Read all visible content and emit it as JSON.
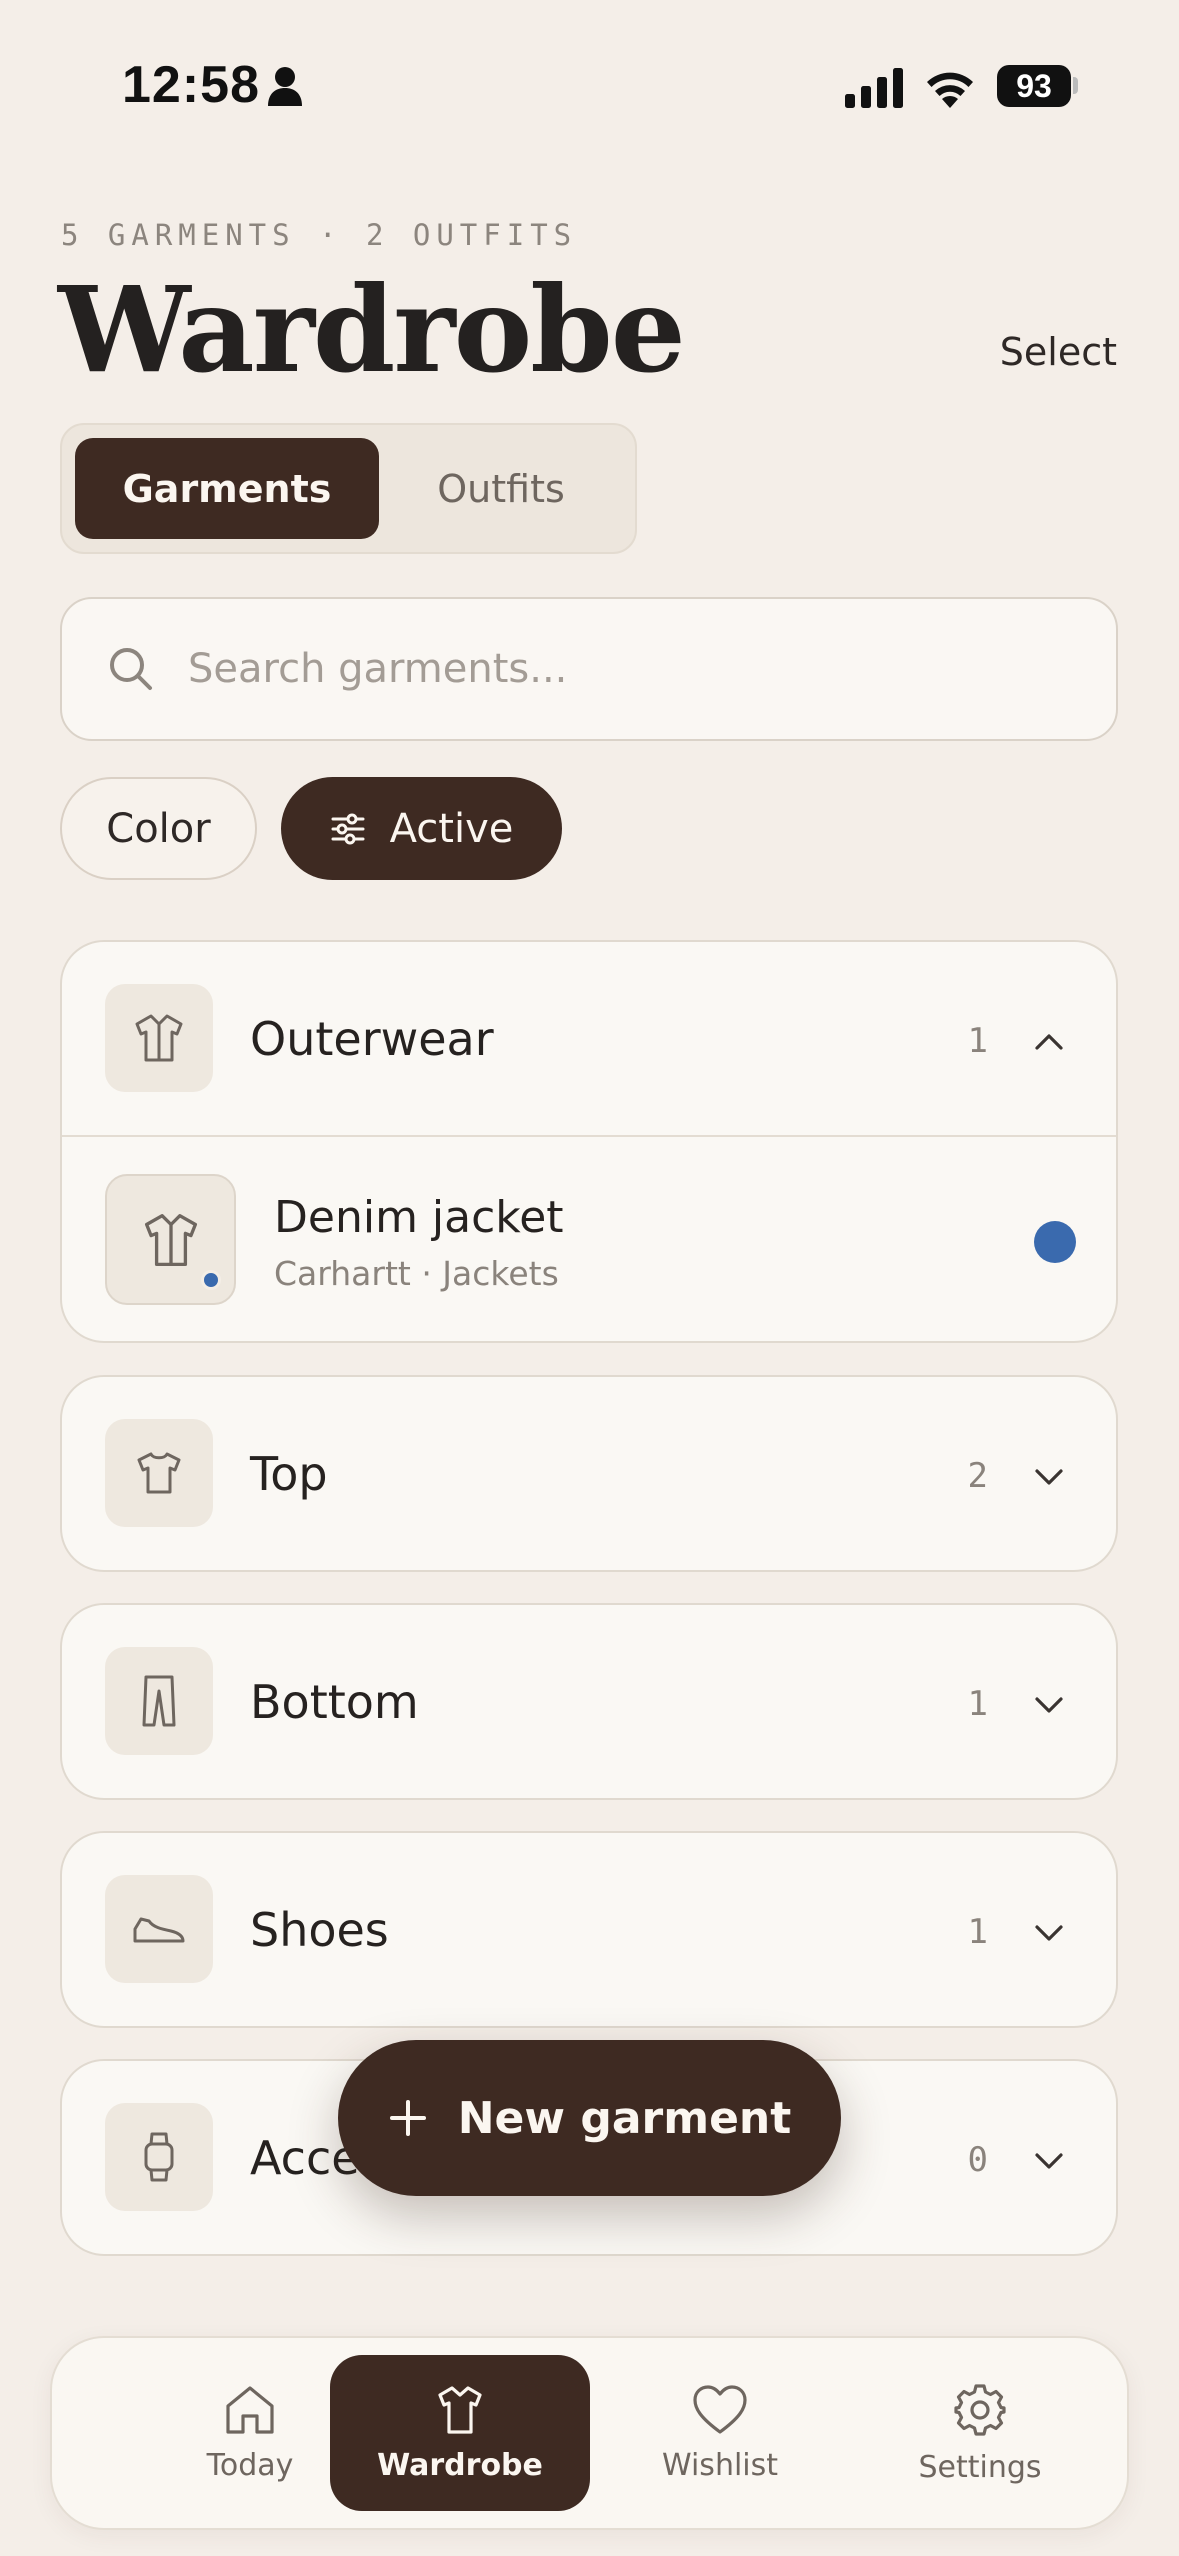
{
  "status_bar": {
    "time": "12:58",
    "battery": "93",
    "icons": [
      "person-icon",
      "signal-icon",
      "wifi-icon",
      "battery-icon"
    ]
  },
  "header": {
    "subtitle": "5 GARMENTS · 2 OUTFITS",
    "title": "Wardrobe",
    "select_label": "Select"
  },
  "segments": {
    "garments": "Garments",
    "outfits": "Outfits",
    "selected": "Garments"
  },
  "search": {
    "placeholder": "Search garments...",
    "value": ""
  },
  "filters": {
    "color": "Color",
    "active": "Active",
    "active_selected": true
  },
  "categories": [
    {
      "label": "Outerwear",
      "count": "1",
      "expanded": true,
      "icon": "jacket-icon",
      "items": [
        {
          "name": "Denim jacket",
          "meta": "Carhartt · Jackets",
          "dot_color": "#3A6AAE"
        }
      ]
    },
    {
      "label": "Top",
      "count": "2",
      "expanded": false,
      "icon": "tshirt-icon"
    },
    {
      "label": "Bottom",
      "count": "1",
      "expanded": false,
      "icon": "pants-icon"
    },
    {
      "label": "Shoes",
      "count": "1",
      "expanded": false,
      "icon": "shoe-icon"
    },
    {
      "label": "Accessories",
      "count": "0",
      "expanded": false,
      "icon": "watch-icon"
    }
  ],
  "fab": {
    "label": "New garment",
    "icon": "plus-icon"
  },
  "tabbar": {
    "tabs": [
      {
        "label": "Today",
        "icon": "home-icon"
      },
      {
        "label": "Wardrobe",
        "icon": "shirt-icon",
        "active": true
      },
      {
        "label": "Wishlist",
        "icon": "heart-icon"
      },
      {
        "label": "Settings",
        "icon": "gear-icon"
      }
    ]
  },
  "colors": {
    "background": "#F4EEE8",
    "accent": "#3E2A22",
    "card": "#FAF8F4",
    "item_dot": "#3A6AAE"
  }
}
